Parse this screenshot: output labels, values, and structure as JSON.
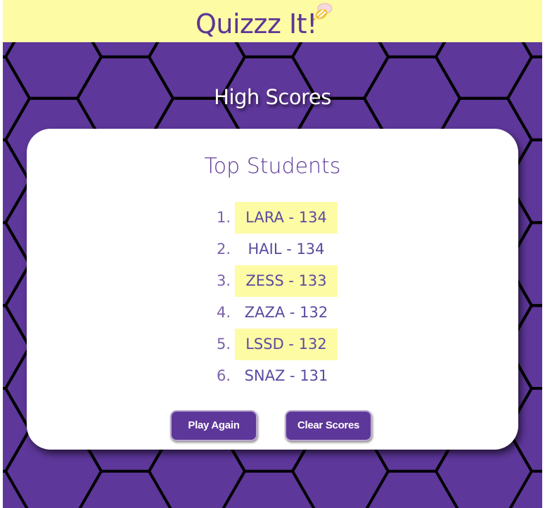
{
  "header": {
    "brand": "Quizzz It!",
    "logo_icon": "bee-icon",
    "background": "#fefba5"
  },
  "main": {
    "title": "High Scores",
    "background": "#5e379a"
  },
  "card": {
    "title": "Top Students",
    "scores": [
      {
        "rank": "1.",
        "entry": "LARA - 134",
        "highlighted": true
      },
      {
        "rank": "2.",
        "entry": "HAIL - 134",
        "highlighted": false
      },
      {
        "rank": "3.",
        "entry": "ZESS - 133",
        "highlighted": true
      },
      {
        "rank": "4.",
        "entry": "ZAZA - 132",
        "highlighted": false
      },
      {
        "rank": "5.",
        "entry": "LSSD - 132",
        "highlighted": true
      },
      {
        "rank": "6.",
        "entry": "SNAZ - 131",
        "highlighted": false
      }
    ]
  },
  "buttons": {
    "play_again": "Play Again",
    "clear_scores": "Clear Scores"
  },
  "colors": {
    "accent": "#5e379a",
    "highlight": "#fefba5",
    "hex_outline": "#000000"
  }
}
